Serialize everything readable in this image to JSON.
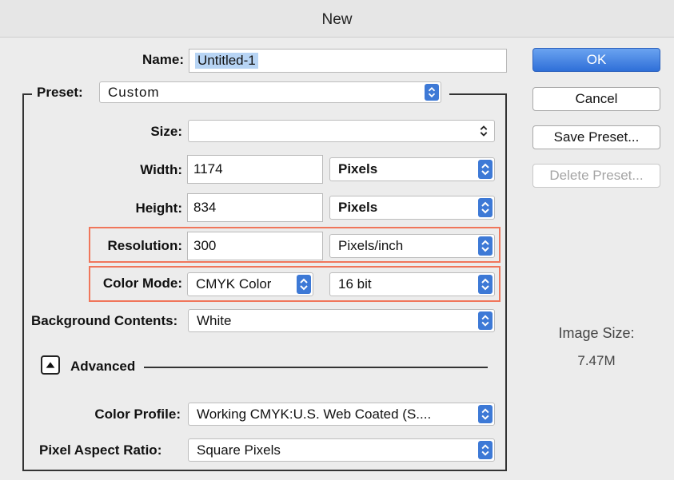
{
  "window": {
    "title": "New"
  },
  "name": {
    "label": "Name:",
    "value": "Untitled-1"
  },
  "preset": {
    "label": "Preset:",
    "value": "Custom"
  },
  "size": {
    "label": "Size:",
    "value": ""
  },
  "width": {
    "label": "Width:",
    "value": "1174",
    "unit": "Pixels"
  },
  "height": {
    "label": "Height:",
    "value": "834",
    "unit": "Pixels"
  },
  "resolution": {
    "label": "Resolution:",
    "value": "300",
    "unit": "Pixels/inch"
  },
  "color_mode": {
    "label": "Color Mode:",
    "value": "CMYK Color",
    "depth": "16 bit"
  },
  "background": {
    "label": "Background Contents:",
    "value": "White"
  },
  "advanced": {
    "label": "Advanced",
    "icon": "triangle-up-icon"
  },
  "color_profile": {
    "label": "Color Profile:",
    "value": "Working CMYK:U.S. Web Coated (S...."
  },
  "pixel_aspect": {
    "label": "Pixel Aspect Ratio:",
    "value": "Square Pixels"
  },
  "buttons": {
    "ok": "OK",
    "cancel": "Cancel",
    "save_preset": "Save Preset...",
    "delete_preset": "Delete Preset..."
  },
  "image_size": {
    "label": "Image Size:",
    "value": "7.47M"
  },
  "colors": {
    "accent": "#3d79d6",
    "highlight": "#f0765b"
  }
}
